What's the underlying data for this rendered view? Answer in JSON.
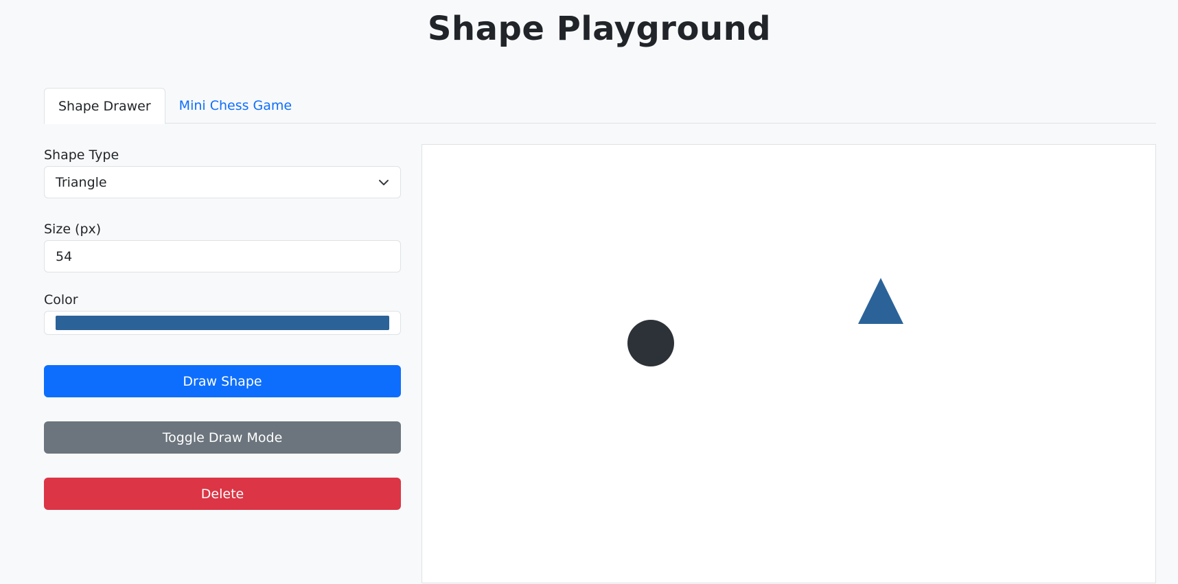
{
  "header": {
    "title": "Shape Playground"
  },
  "tabs": [
    {
      "label": "Shape Drawer",
      "active": true
    },
    {
      "label": "Mini Chess Game",
      "active": false
    }
  ],
  "form": {
    "shape_type": {
      "label": "Shape Type",
      "value": "Triangle",
      "options": [
        "Triangle"
      ]
    },
    "size": {
      "label": "Size (px)",
      "value": "54"
    },
    "color": {
      "label": "Color",
      "value": "#2b6399"
    }
  },
  "buttons": {
    "draw": "Draw Shape",
    "toggle": "Toggle Draw Mode",
    "delete": "Delete"
  },
  "colors": {
    "primary": "#0d6efd",
    "secondary": "#6c757d",
    "danger": "#dc3545",
    "circle_fill": "#2d3238",
    "triangle_fill": "#2b6399"
  },
  "icons": {
    "select_toggle": "chevron-down-icon"
  }
}
